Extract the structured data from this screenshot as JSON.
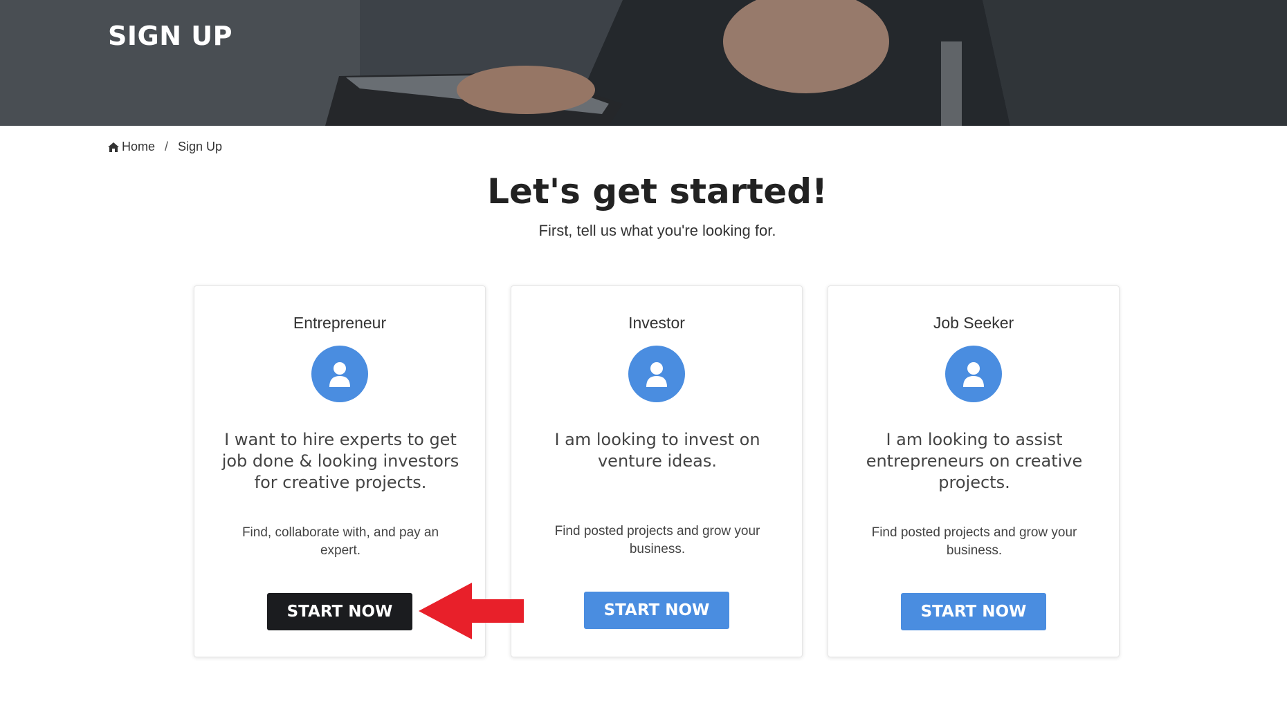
{
  "hero": {
    "title": "SIGN UP"
  },
  "breadcrumb": {
    "home": "Home",
    "separator": "/",
    "current": "Sign Up"
  },
  "main": {
    "heading": "Let's get started!",
    "subheading": "First, tell us what you're looking for."
  },
  "cards": [
    {
      "title": "Entrepreneur",
      "icon": "user-icon",
      "description": "I want to hire experts to get job done & looking investors for creative projects.",
      "subtext": "Find, collaborate with, and pay an expert.",
      "button": "START NOW"
    },
    {
      "title": "Investor",
      "icon": "user-icon",
      "description": "I am looking to invest on venture ideas.",
      "subtext": "Find posted projects and grow your business.",
      "button": "START NOW"
    },
    {
      "title": "Job Seeker",
      "icon": "user-icon",
      "description": "I am looking to assist entrepreneurs on creative projects.",
      "subtext": "Find posted projects and grow your business.",
      "button": "START NOW"
    }
  ],
  "colors": {
    "accent": "#4a8de0",
    "active_button": "#1b1c1f",
    "annotation_arrow": "#e8202a"
  }
}
